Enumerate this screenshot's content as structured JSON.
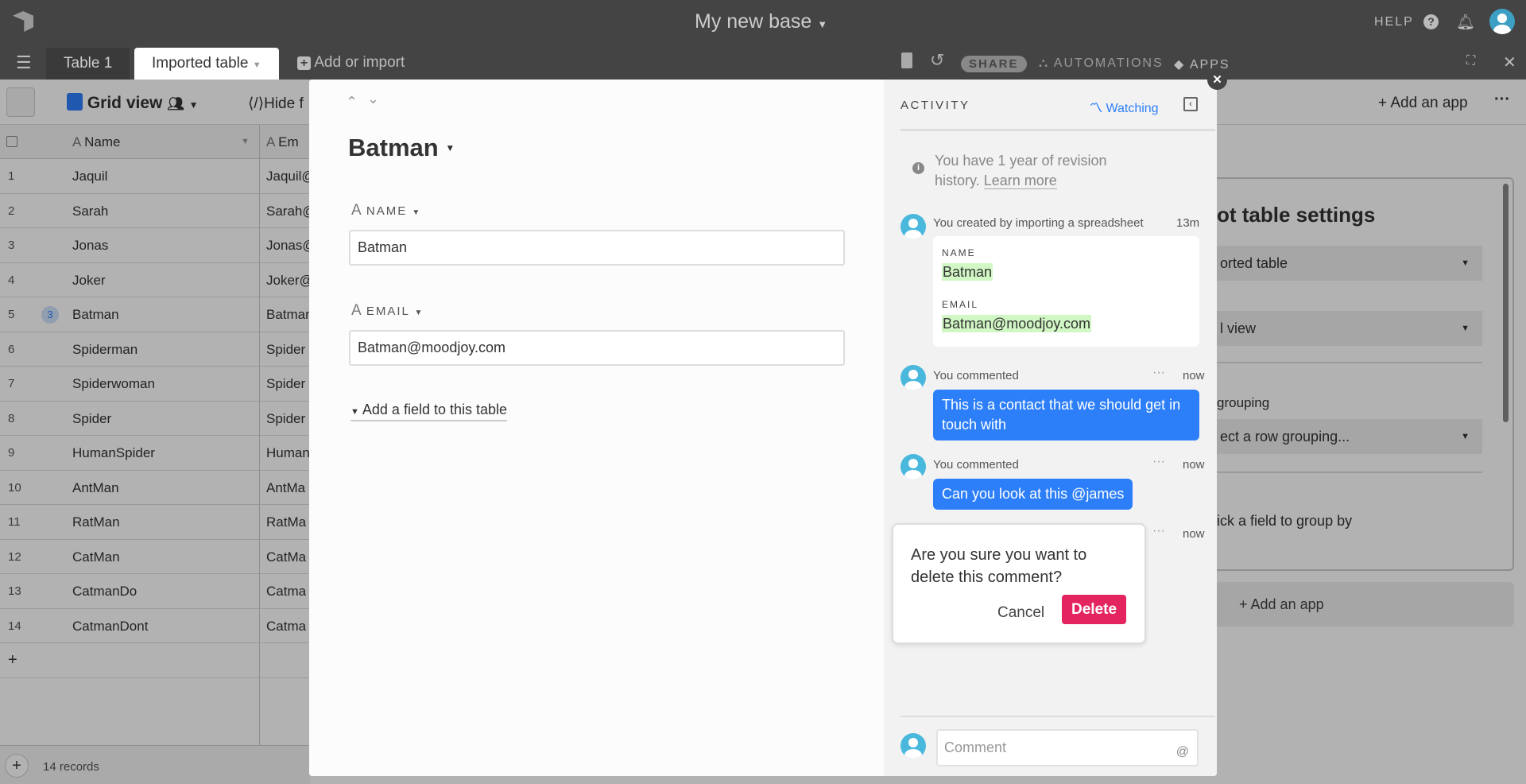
{
  "app": {
    "base_name": "My new base",
    "help": "HELP"
  },
  "tabs": [
    {
      "label": "Table 1"
    },
    {
      "label": "Imported table"
    }
  ],
  "add_or_import": "Add or import",
  "toolbar_actions": {
    "share": "SHARE",
    "automations": "AUTOMATIONS",
    "apps": "APPS",
    "add_app": "Add an app"
  },
  "view": {
    "name": "Grid view",
    "hide_fields": "Hide f"
  },
  "columns": [
    {
      "label": "Name"
    },
    {
      "label": "Em"
    }
  ],
  "rows": [
    {
      "n": "1",
      "name": "Jaquil",
      "email": "Jaquil@"
    },
    {
      "n": "2",
      "name": "Sarah",
      "email": "Sarah@"
    },
    {
      "n": "3",
      "name": "Jonas",
      "email": "Jonas@"
    },
    {
      "n": "4",
      "name": "Joker",
      "email": "Joker@"
    },
    {
      "n": "5",
      "name": "Batman",
      "email": "Batman",
      "badge": "3"
    },
    {
      "n": "6",
      "name": "Spiderman",
      "email": "Spider"
    },
    {
      "n": "7",
      "name": "Spiderwoman",
      "email": "Spider"
    },
    {
      "n": "8",
      "name": "Spider",
      "email": "Spider"
    },
    {
      "n": "9",
      "name": "HumanSpider",
      "email": "Human"
    },
    {
      "n": "10",
      "name": "AntMan",
      "email": "AntMa"
    },
    {
      "n": "11",
      "name": "RatMan",
      "email": "RatMa"
    },
    {
      "n": "12",
      "name": "CatMan",
      "email": "CatMa"
    },
    {
      "n": "13",
      "name": "CatmanDo",
      "email": "Catma"
    },
    {
      "n": "14",
      "name": "CatmanDont",
      "email": "Catma"
    }
  ],
  "add_row": "+",
  "record_count": "14 records",
  "right_panel": {
    "title": "ot table settings",
    "table_select": "orted table",
    "view_select": "l view",
    "grouping_label": "grouping",
    "grouping_select": "ect a row grouping...",
    "group_hint": "ick a field to group by",
    "add_app": "Add an app"
  },
  "record": {
    "title": "Batman",
    "fields": [
      {
        "label": "NAME",
        "value": "Batman"
      },
      {
        "label": "EMAIL",
        "value": "Batman@moodjoy.com"
      }
    ],
    "add_field": "Add a field to this table"
  },
  "activity": {
    "header": "ACTIVITY",
    "watching": "Watching",
    "info_line1": "You have 1 year of revision",
    "info_line2": "history.",
    "learn_more": "Learn more",
    "created": {
      "text": "You created by importing a spreadsheet",
      "time": "13m",
      "fields": [
        {
          "label": "NAME",
          "value": "Batman"
        },
        {
          "label": "EMAIL",
          "value": "Batman@moodjoy.com"
        }
      ]
    },
    "comments": [
      {
        "author": "You commented",
        "time": "now",
        "text": "This is a contact that we should get in touch with"
      },
      {
        "author": "You commented",
        "time": "now",
        "text": "Can you look at this @james"
      },
      {
        "time": "now"
      }
    ],
    "comment_placeholder": "Comment",
    "mention": "@"
  },
  "confirm": {
    "message": "Are you sure you want to delete this comment?",
    "cancel": "Cancel",
    "delete": "Delete"
  },
  "colors": {
    "accent": "#2d7ff9",
    "delete": "#e4245f",
    "avatar": "#4ab8dc",
    "topbar": "#444444"
  }
}
